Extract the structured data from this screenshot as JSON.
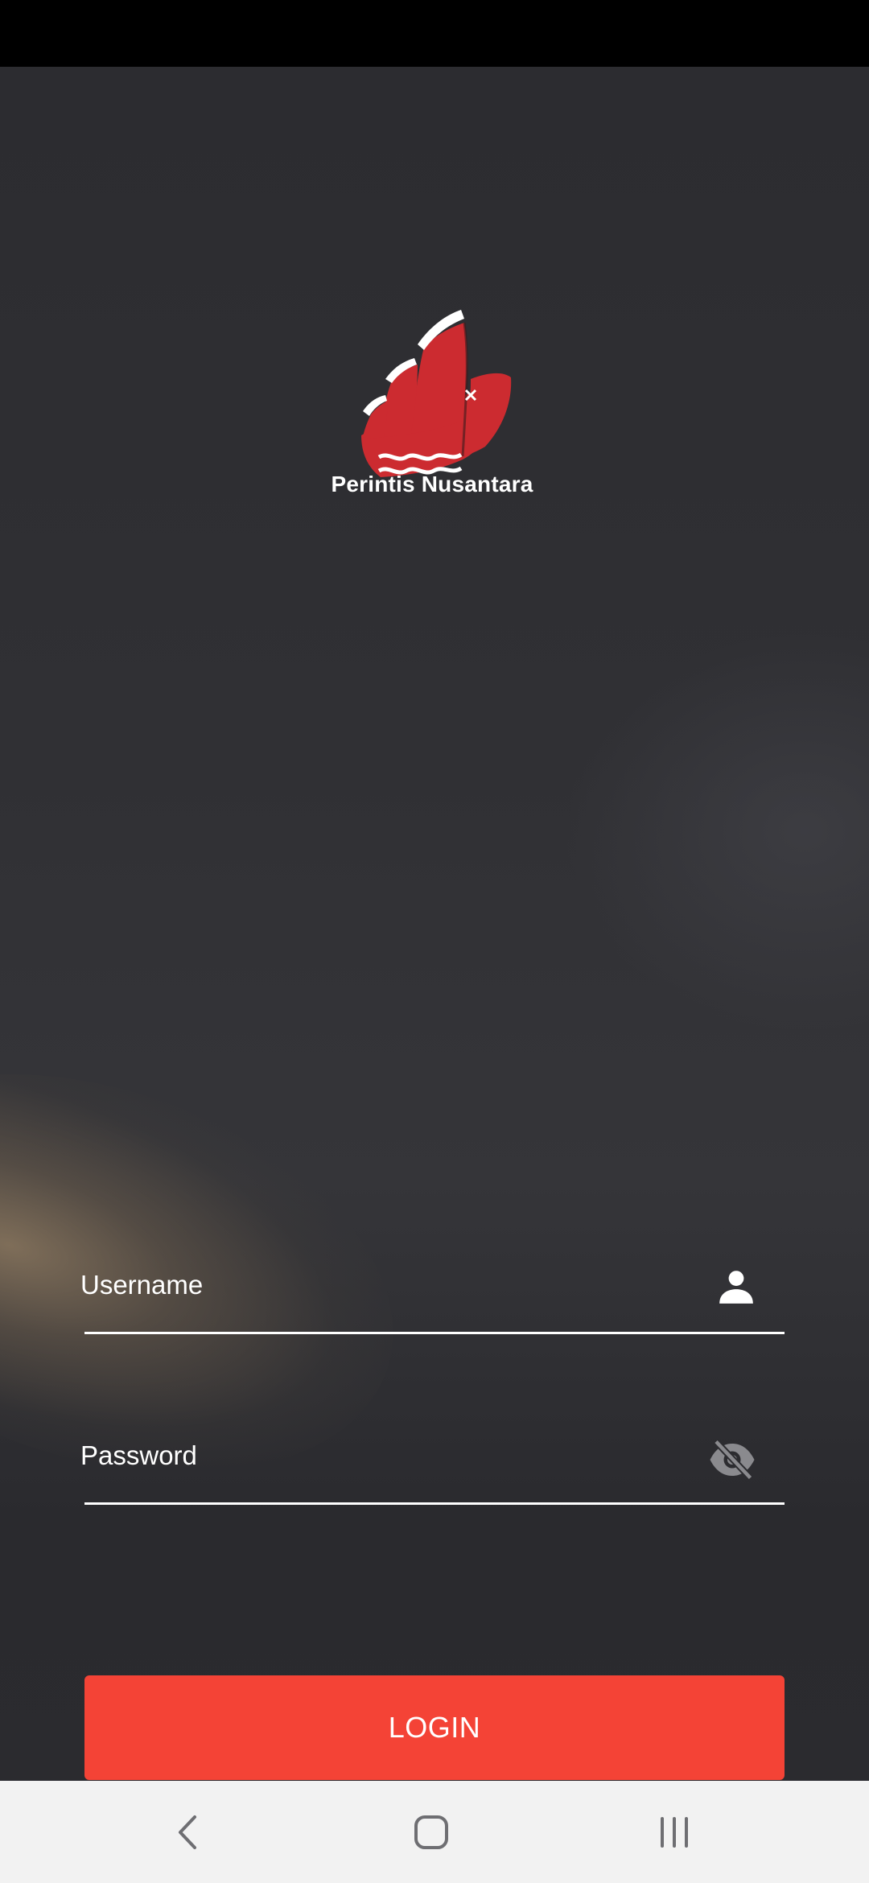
{
  "app": {
    "name": "Perintis Nusantara"
  },
  "login_form": {
    "username_placeholder": "Username",
    "password_placeholder": "Password",
    "login_label": "LOGIN"
  },
  "icons": {
    "username": "person-icon",
    "password": "visibility-off-icon"
  },
  "navigation": {
    "back": "back-icon",
    "home": "home-icon",
    "recents": "recents-icon"
  },
  "colors": {
    "accent": "#f44336",
    "logo_red": "#cc2b30",
    "background": "#2f2f33",
    "nav_background": "#f2f2f2"
  }
}
